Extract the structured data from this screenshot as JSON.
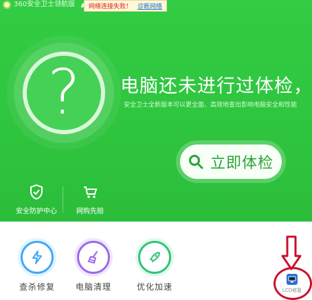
{
  "app": {
    "title": "360安全卫士领航版"
  },
  "network_alert": {
    "message": "网络连接失败！",
    "link": "诊断网络"
  },
  "checkup": {
    "headline": "电脑还未进行过体检，建",
    "subtext": "安全卫士全新版本可以更全面、高效地查出影响电脑安全和性能",
    "button_label": "立即体检"
  },
  "features": [
    {
      "label": "安全防护中心",
      "icon": "shield-icon"
    },
    {
      "label": "网购先赔",
      "icon": "cart-icon"
    }
  ],
  "tools": [
    {
      "label": "查杀修复",
      "icon": "lightning-icon",
      "color": "#42a8f5"
    },
    {
      "label": "电脑清理",
      "icon": "broom-icon",
      "color": "#9b6ae6"
    },
    {
      "label": "优化加速",
      "icon": "rocket-icon",
      "color": "#2fc47a"
    }
  ],
  "lcd_tool": {
    "label": "LCD修复",
    "icon": "lcd-icon"
  },
  "colors": {
    "brand_green": "#2fc53f",
    "annotation_red": "#c8102e"
  }
}
